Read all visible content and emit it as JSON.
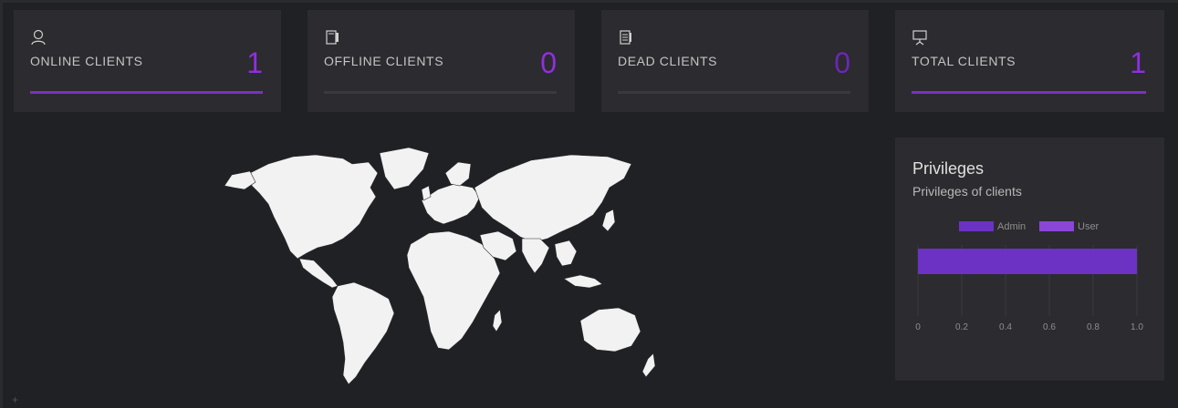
{
  "stats": [
    {
      "icon": "user-icon",
      "label": "ONLINE CLIENTS",
      "value": "1",
      "progress": 1,
      "value_color": "#8f2fe0"
    },
    {
      "icon": "notebook-icon",
      "label": "OFFLINE CLIENTS",
      "value": "0",
      "progress": 0,
      "value_color": "#8f2fe0"
    },
    {
      "icon": "document-icon",
      "label": "DEAD CLIENTS",
      "value": "0",
      "progress": 0,
      "value_color": "#6a27b8"
    },
    {
      "icon": "presentation-icon",
      "label": "TOTAL CLIENTS",
      "value": "1",
      "progress": 1,
      "value_color": "#8f2fe0"
    }
  ],
  "colors": {
    "accent": "#7b2fc9",
    "admin": "#6b32c4",
    "user": "#8a45d9",
    "card": "#2c2b2f",
    "background": "#1f2124",
    "map_fill": "#f2f2f2"
  },
  "map": {
    "icon": "world-map"
  },
  "privileges": {
    "title": "Privileges",
    "subtitle": "Privileges of clients"
  },
  "chart_data": {
    "type": "bar",
    "orientation": "horizontal",
    "title": "",
    "legend": [
      "Admin",
      "User"
    ],
    "legend_position": "top",
    "series": [
      {
        "name": "Admin",
        "values": [
          1
        ]
      },
      {
        "name": "User",
        "values": [
          0
        ]
      }
    ],
    "categories": [
      ""
    ],
    "xlim": [
      0,
      1.0
    ],
    "ticks": [
      "0",
      "0.2",
      "0.4",
      "0.6",
      "0.8",
      "1.0"
    ],
    "grid": true
  },
  "footer": {
    "plus": "+"
  }
}
